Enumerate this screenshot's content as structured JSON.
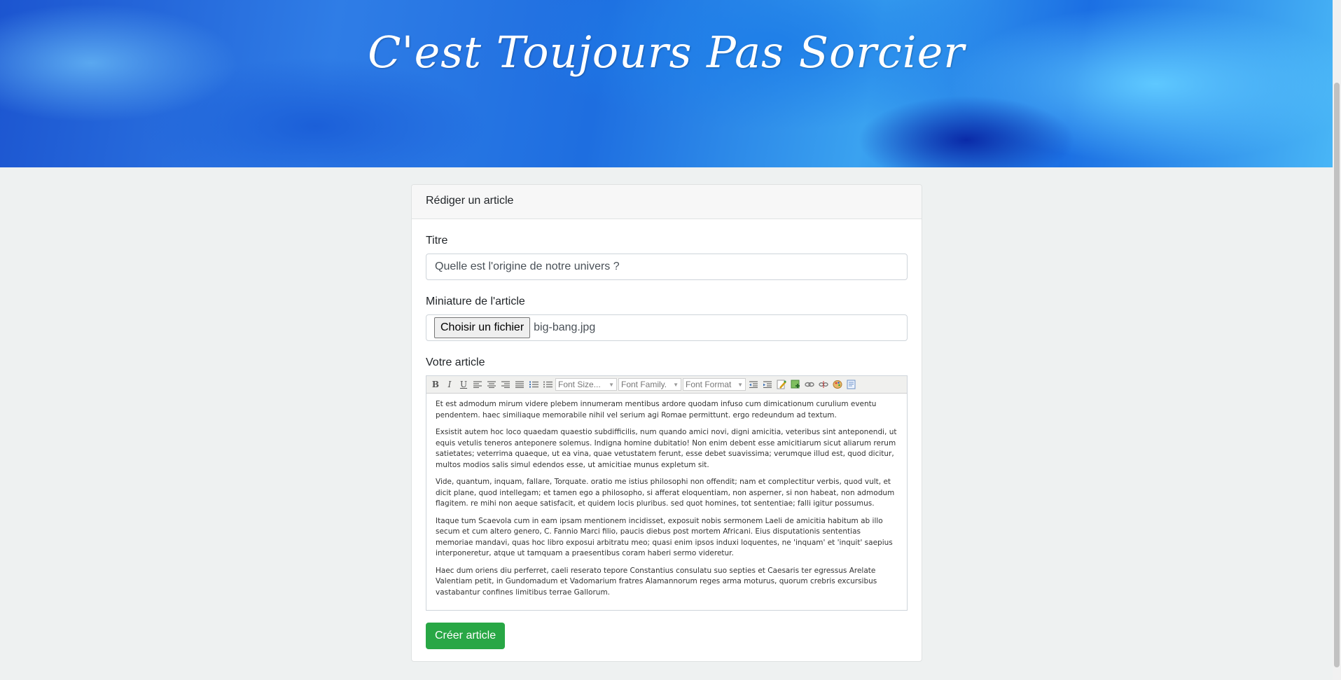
{
  "site": {
    "title": "C'est Toujours Pas Sorcier"
  },
  "card": {
    "header": "Rédiger un article"
  },
  "form": {
    "title_label": "Titre",
    "title_value": "Quelle est l'origine de notre univers ?",
    "thumbnail_label": "Miniature de l'article",
    "file_button": "Choisir un fichier",
    "file_name": "big-bang.jpg",
    "article_label": "Votre article",
    "submit_label": "Créer article"
  },
  "toolbar": {
    "bold": "B",
    "italic": "I",
    "underline": "U",
    "font_size": "Font Size...",
    "font_family": "Font Family.",
    "font_format": "Font Format"
  },
  "editor": {
    "p1": "Et est admodum mirum videre plebem innumeram mentibus ardore quodam infuso cum dimicationum curulium eventu pendentem. haec similiaque memorabile nihil vel serium agi Romae permittunt. ergo redeundum ad textum.",
    "p2": "Exsistit autem hoc loco quaedam quaestio subdifficilis, num quando amici novi, digni amicitia, veteribus sint anteponendi, ut equis vetulis teneros anteponere solemus. Indigna homine dubitatio! Non enim debent esse amicitiarum sicut aliarum rerum satietates; veterrima quaeque, ut ea vina, quae vetustatem ferunt, esse debet suavissima; verumque illud est, quod dicitur, multos modios salis simul edendos esse, ut amicitiae munus expletum sit.",
    "p3": "Vide, quantum, inquam, fallare, Torquate. oratio me istius philosophi non offendit; nam et complectitur verbis, quod vult, et dicit plane, quod intellegam; et tamen ego a philosopho, si afferat eloquentiam, non asperner, si non habeat, non admodum flagitem. re mihi non aeque satisfacit, et quidem locis pluribus. sed quot homines, tot sententiae; falli igitur possumus.",
    "p4": "Itaque tum Scaevola cum in eam ipsam mentionem incidisset, exposuit nobis sermonem Laeli de amicitia habitum ab illo secum et cum altero genero, C. Fannio Marci filio, paucis diebus post mortem Africani. Eius disputationis sententias memoriae mandavi, quas hoc libro exposui arbitratu meo; quasi enim ipsos induxi loquentes, ne 'inquam' et 'inquit' saepius interponeretur, atque ut tamquam a praesentibus coram haberi sermo videretur.",
    "p5": "Haec dum oriens diu perferret, caeli reserato tepore Constantius consulatu suo septies et Caesaris ter egressus Arelate Valentiam petit, in Gundomadum et Vadomarium fratres Alamannorum reges arma moturus, quorum crebris excursibus vastabantur confines limitibus terrae Gallorum."
  },
  "colors": {
    "submit": "#28a745",
    "background": "#eef1f1"
  }
}
